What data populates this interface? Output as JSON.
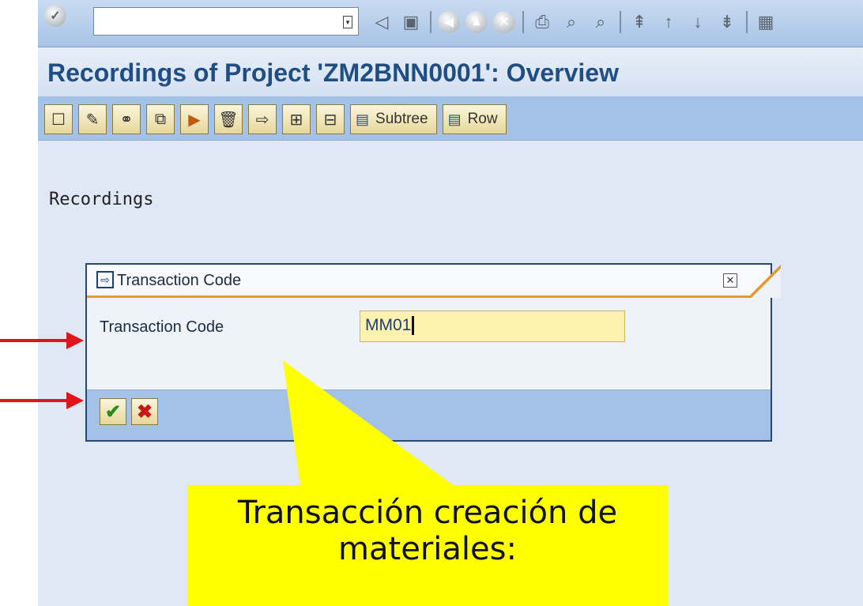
{
  "systembar": {
    "command_field_value": "",
    "icons": [
      "back-icon",
      "save-icon",
      "back-nav-icon",
      "exit-icon",
      "cancel-icon",
      "print-icon",
      "find-icon",
      "find-next-icon",
      "first-page-icon",
      "previous-page-icon",
      "next-page-icon",
      "last-page-icon",
      "new-session-icon"
    ]
  },
  "header": {
    "title": "Recordings of Project 'ZM2BNN0001': Overview"
  },
  "apptoolbar": {
    "buttons": [
      {
        "name": "create-icon"
      },
      {
        "name": "edit-icon"
      },
      {
        "name": "display-icon"
      },
      {
        "name": "copy-icon"
      },
      {
        "name": "execute-icon"
      },
      {
        "name": "delete-icon"
      },
      {
        "name": "export-icon"
      },
      {
        "name": "expand-icon"
      },
      {
        "name": "collapse-icon"
      }
    ],
    "subtree_label": "Subtree",
    "row_label": "Row"
  },
  "content": {
    "section_label": "Recordings"
  },
  "dialog": {
    "title": "Transaction Code",
    "field_label": "Transaction Code",
    "field_value": "MM01"
  },
  "annotation": {
    "callout_text": "Transacción creación de materiales:",
    "callout_color": "#ffff00",
    "arrow_color": "#e0151b"
  },
  "colors": {
    "title": "#1f4e86",
    "toolbar": "#a4c1e8",
    "input_highlight": "#fdf1b0"
  }
}
